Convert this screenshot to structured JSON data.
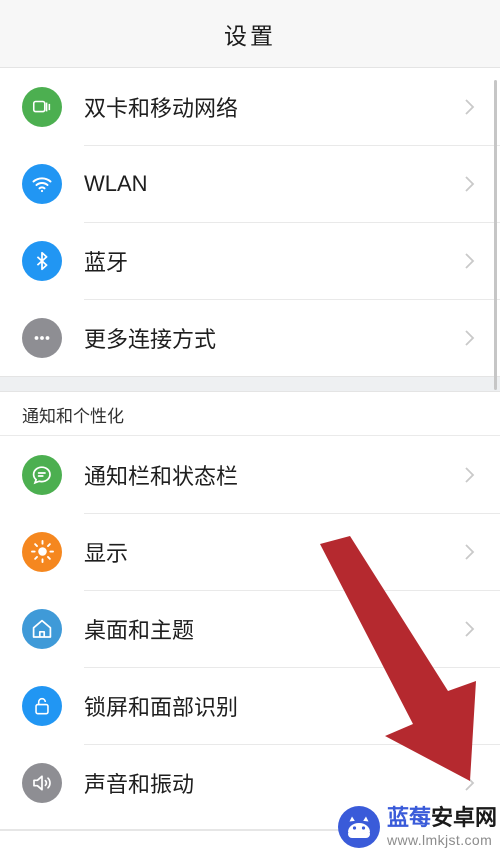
{
  "header": {
    "title": "设置"
  },
  "groups": [
    {
      "name": "connectivity",
      "header": null,
      "items": [
        {
          "label": "双卡和移动网络",
          "icon": "sim-card-icon",
          "icon_color": "#4caf50",
          "chevron": "chevron-right-icon"
        },
        {
          "label": "WLAN",
          "icon": "wifi-icon",
          "icon_color": "#2196f3",
          "chevron": "chevron-right-icon"
        },
        {
          "label": "蓝牙",
          "icon": "bluetooth-icon",
          "icon_color": "#2196f3",
          "chevron": "chevron-right-icon"
        },
        {
          "label": "更多连接方式",
          "icon": "more-dots-icon",
          "icon_color": "#8e8e93",
          "chevron": "chevron-right-icon"
        }
      ]
    },
    {
      "name": "notifications-personalization",
      "header": "通知和个性化",
      "items": [
        {
          "label": "通知栏和状态栏",
          "icon": "chat-bubble-icon",
          "icon_color": "#4caf50",
          "chevron": "chevron-right-icon"
        },
        {
          "label": "显示",
          "icon": "brightness-icon",
          "icon_color": "#f5871f",
          "chevron": "chevron-right-icon"
        },
        {
          "label": "桌面和主题",
          "icon": "home-icon",
          "icon_color": "#3f9ad8",
          "chevron": "chevron-right-icon"
        },
        {
          "label": "锁屏和面部识别",
          "icon": "lock-icon",
          "icon_color": "#2196f3",
          "chevron": "chevron-right-icon"
        },
        {
          "label": "声音和振动",
          "icon": "speaker-icon",
          "icon_color": "#8e8e93",
          "chevron": "chevron-right-icon"
        }
      ]
    }
  ],
  "annotation": {
    "arrow": "red-down-right-arrow",
    "color": "#b5292f"
  },
  "watermark": {
    "logo": "blueberry-android-logo-icon",
    "title_part1": "蓝莓",
    "title_part2": "安卓网",
    "url": "www.lmkjst.com",
    "brand_color": "#3a5bd9"
  },
  "scrollbar": {
    "name": "vertical-scrollbar"
  }
}
